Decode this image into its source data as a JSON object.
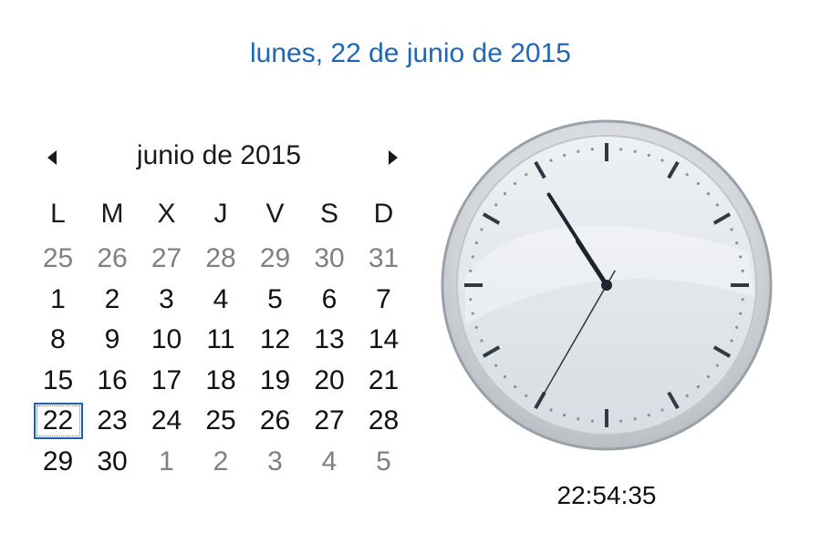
{
  "long_date": "lunes, 22 de junio de 2015",
  "calendar": {
    "month_label": "junio de 2015",
    "prev_icon": "chevron-left-icon",
    "next_icon": "chevron-right-icon",
    "weekdays": [
      "L",
      "M",
      "X",
      "J",
      "V",
      "S",
      "D"
    ],
    "days": [
      {
        "n": "25",
        "muted": true
      },
      {
        "n": "26",
        "muted": true
      },
      {
        "n": "27",
        "muted": true
      },
      {
        "n": "28",
        "muted": true
      },
      {
        "n": "29",
        "muted": true
      },
      {
        "n": "30",
        "muted": true
      },
      {
        "n": "31",
        "muted": true
      },
      {
        "n": "1"
      },
      {
        "n": "2"
      },
      {
        "n": "3"
      },
      {
        "n": "4"
      },
      {
        "n": "5"
      },
      {
        "n": "6"
      },
      {
        "n": "7"
      },
      {
        "n": "8"
      },
      {
        "n": "9"
      },
      {
        "n": "10"
      },
      {
        "n": "11"
      },
      {
        "n": "12"
      },
      {
        "n": "13"
      },
      {
        "n": "14"
      },
      {
        "n": "15"
      },
      {
        "n": "16"
      },
      {
        "n": "17"
      },
      {
        "n": "18"
      },
      {
        "n": "19"
      },
      {
        "n": "20"
      },
      {
        "n": "21"
      },
      {
        "n": "22",
        "today": true
      },
      {
        "n": "23"
      },
      {
        "n": "24"
      },
      {
        "n": "25"
      },
      {
        "n": "26"
      },
      {
        "n": "27"
      },
      {
        "n": "28"
      },
      {
        "n": "29"
      },
      {
        "n": "30"
      },
      {
        "n": "1",
        "muted": true
      },
      {
        "n": "2",
        "muted": true
      },
      {
        "n": "3",
        "muted": true
      },
      {
        "n": "4",
        "muted": true
      },
      {
        "n": "5",
        "muted": true
      }
    ],
    "colors": {
      "accent": "#1e67b8",
      "muted": "#808080",
      "text": "#111111",
      "today_border": "#1f5fae"
    }
  },
  "clock": {
    "time": "22:54:35",
    "hour": 22,
    "minute": 54,
    "second": 35
  }
}
